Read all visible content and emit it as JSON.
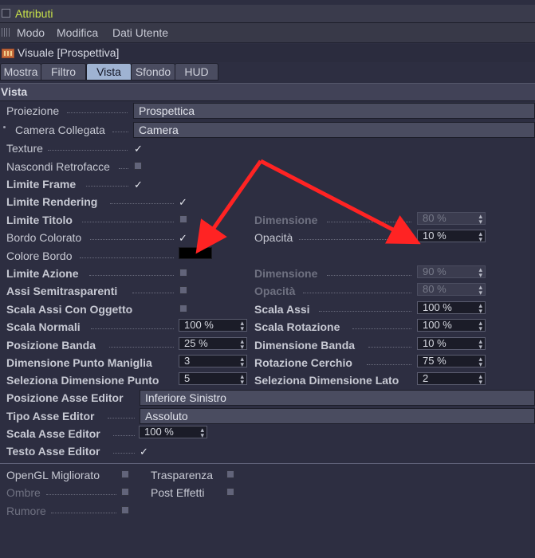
{
  "title_bar": {
    "title": "Attributi"
  },
  "menu": {
    "items": [
      "Modo",
      "Modifica",
      "Dati Utente"
    ]
  },
  "object": {
    "title": "Visuale [Prospettiva]"
  },
  "tabs": [
    {
      "label": "Mostra"
    },
    {
      "label": "Filtro"
    },
    {
      "label": "Vista",
      "active": true
    },
    {
      "label": "Sfondo"
    },
    {
      "label": "HUD"
    }
  ],
  "section": {
    "title": "Vista"
  },
  "fields": {
    "proiezione": {
      "label": "Proiezione",
      "value": "Prospettica"
    },
    "camera_collegata": {
      "label": "Camera Collegata",
      "value": "Camera"
    },
    "texture": {
      "label": "Texture",
      "checked": true
    },
    "nascondi_retrofacce": {
      "label": "Nascondi Retrofacce",
      "checked": false
    },
    "limite_frame": {
      "label": "Limite Frame",
      "checked": true
    },
    "limite_rendering": {
      "label": "Limite Rendering",
      "checked": true
    },
    "limite_titolo": {
      "label": "Limite Titolo",
      "checked": false
    },
    "limite_titolo_dimensione": {
      "label": "Dimensione",
      "value": "80 %"
    },
    "bordo_colorato": {
      "label": "Bordo Colorato",
      "checked": true
    },
    "bordo_colorato_opacita": {
      "label": "Opacità",
      "value": "10 %"
    },
    "colore_bordo": {
      "label": "Colore Bordo",
      "color": "#000000"
    },
    "limite_azione": {
      "label": "Limite Azione",
      "checked": false
    },
    "limite_azione_dimensione": {
      "label": "Dimensione",
      "value": "90 %"
    },
    "assi_semitrasparenti": {
      "label": "Assi Semitrasparenti",
      "checked": false
    },
    "assi_opacita": {
      "label": "Opacità",
      "value": "80 %"
    },
    "scala_assi_con_oggetto": {
      "label": "Scala Assi Con Oggetto",
      "checked": false
    },
    "scala_assi": {
      "label": "Scala Assi",
      "value": "100 %"
    },
    "scala_normali": {
      "label": "Scala Normali",
      "value": "100 %"
    },
    "scala_rotazione": {
      "label": "Scala Rotazione",
      "value": "100 %"
    },
    "posizione_banda": {
      "label": "Posizione Banda",
      "value": "25 %"
    },
    "dimensione_banda": {
      "label": "Dimensione Banda",
      "value": "10 %"
    },
    "dimensione_punto_maniglia": {
      "label": "Dimensione Punto Maniglia",
      "value": "3"
    },
    "rotazione_cerchio": {
      "label": "Rotazione Cerchio",
      "value": "75 %"
    },
    "seleziona_dimensione_punto": {
      "label": "Seleziona Dimensione Punto",
      "value": "5"
    },
    "seleziona_dimensione_lato": {
      "label": "Seleziona Dimensione Lato",
      "value": "2"
    },
    "posizione_asse_editor": {
      "label": "Posizione Asse Editor",
      "value": "Inferiore Sinistro"
    },
    "tipo_asse_editor": {
      "label": "Tipo Asse Editor",
      "value": "Assoluto"
    },
    "scala_asse_editor": {
      "label": "Scala Asse Editor",
      "value": "100 %"
    },
    "testo_asse_editor": {
      "label": "Testo Asse Editor",
      "checked": true
    },
    "opengl_migliorato": {
      "label": "OpenGL Migliorato",
      "checked": false
    },
    "trasparenza": {
      "label": "Trasparenza",
      "checked": false
    },
    "ombre": {
      "label": "Ombre",
      "checked": false
    },
    "post_effetti": {
      "label": "Post Effetti",
      "checked": false
    },
    "rumore": {
      "label": "Rumore",
      "checked": false
    }
  },
  "glyphs": {
    "tick": "✓"
  },
  "annotation": {
    "arrow_color": "#ff2323"
  }
}
